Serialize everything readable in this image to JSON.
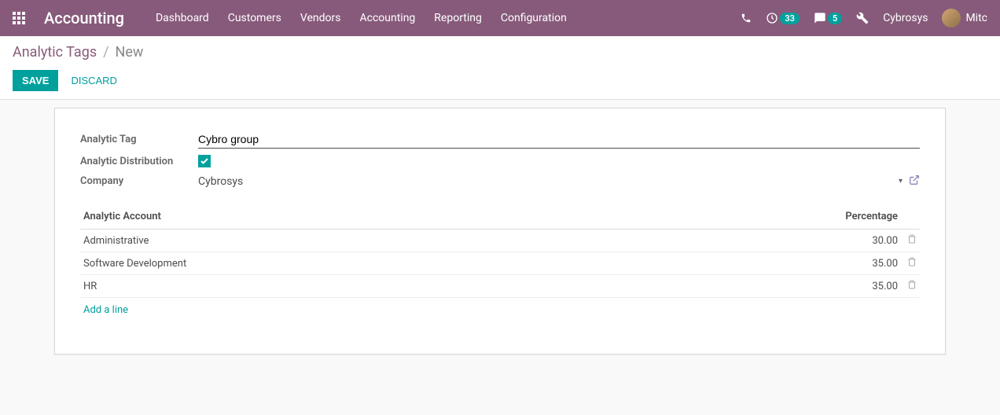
{
  "header": {
    "app_title": "Accounting",
    "menu": [
      "Dashboard",
      "Customers",
      "Vendors",
      "Accounting",
      "Reporting",
      "Configuration"
    ],
    "clock_badge": "33",
    "chat_badge": "5",
    "company": "Cybrosys",
    "user": "Mitc"
  },
  "breadcrumb": {
    "parent": "Analytic Tags",
    "current": "New"
  },
  "buttons": {
    "save": "SAVE",
    "discard": "DISCARD"
  },
  "form": {
    "labels": {
      "analytic_tag": "Analytic Tag",
      "analytic_distribution": "Analytic Distribution",
      "company": "Company"
    },
    "values": {
      "name": "Cybro group",
      "company": "Cybrosys"
    }
  },
  "table": {
    "headers": {
      "account": "Analytic Account",
      "percentage": "Percentage"
    },
    "rows": [
      {
        "account": "Administrative",
        "percentage": "30.00"
      },
      {
        "account": "Software Development",
        "percentage": "35.00"
      },
      {
        "account": "HR",
        "percentage": "35.00"
      }
    ],
    "add_line": "Add a line"
  }
}
